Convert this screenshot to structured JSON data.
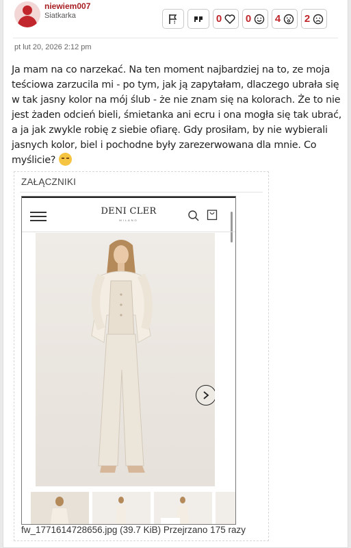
{
  "author": {
    "username": "niewiem007",
    "rank": "Siatkarka"
  },
  "actions": [
    {
      "icon": "report-flag-icon",
      "count": ""
    },
    {
      "icon": "quote-icon",
      "count": ""
    },
    {
      "icon": "heart-icon",
      "count": "0"
    },
    {
      "icon": "smile-icon",
      "count": "0"
    },
    {
      "icon": "surprised-icon",
      "count": "4"
    },
    {
      "icon": "sad-icon",
      "count": "2"
    }
  ],
  "post": {
    "date": "pt lut 20, 2026 2:12 pm",
    "text": "Ja mam na co narzekać. Na ten moment najbardziej na to, ze moja teściowa zarzucila mi - po tym, jak ją zapytałam, dlaczego ubrała się w tak jasny kolor na mój ślub - że nie znam się na kolorach. Że to nie jest żaden odcień bieli, śmietanka ani ecru i ona mogła się tak ubrać, a ja jak zwykle robię z siebie ofiarę. Gdy prosiłam, by nie wybierali jasnych kolor, biel i pochodne były zarezerwowana dla mnie. Co myślicie?",
    "emoji": "pensive-face-emoji"
  },
  "attachments": {
    "title": "ZAŁĄCZNIKI",
    "screenshot": {
      "brand": "DENI CLER",
      "brand_sub": "MILANO"
    },
    "file_info": "fw_1771614728656.jpg (39.7 KiB) Przejrzano 175 razy"
  },
  "colors": {
    "accent": "#c0262c",
    "username": "#a81d22"
  }
}
